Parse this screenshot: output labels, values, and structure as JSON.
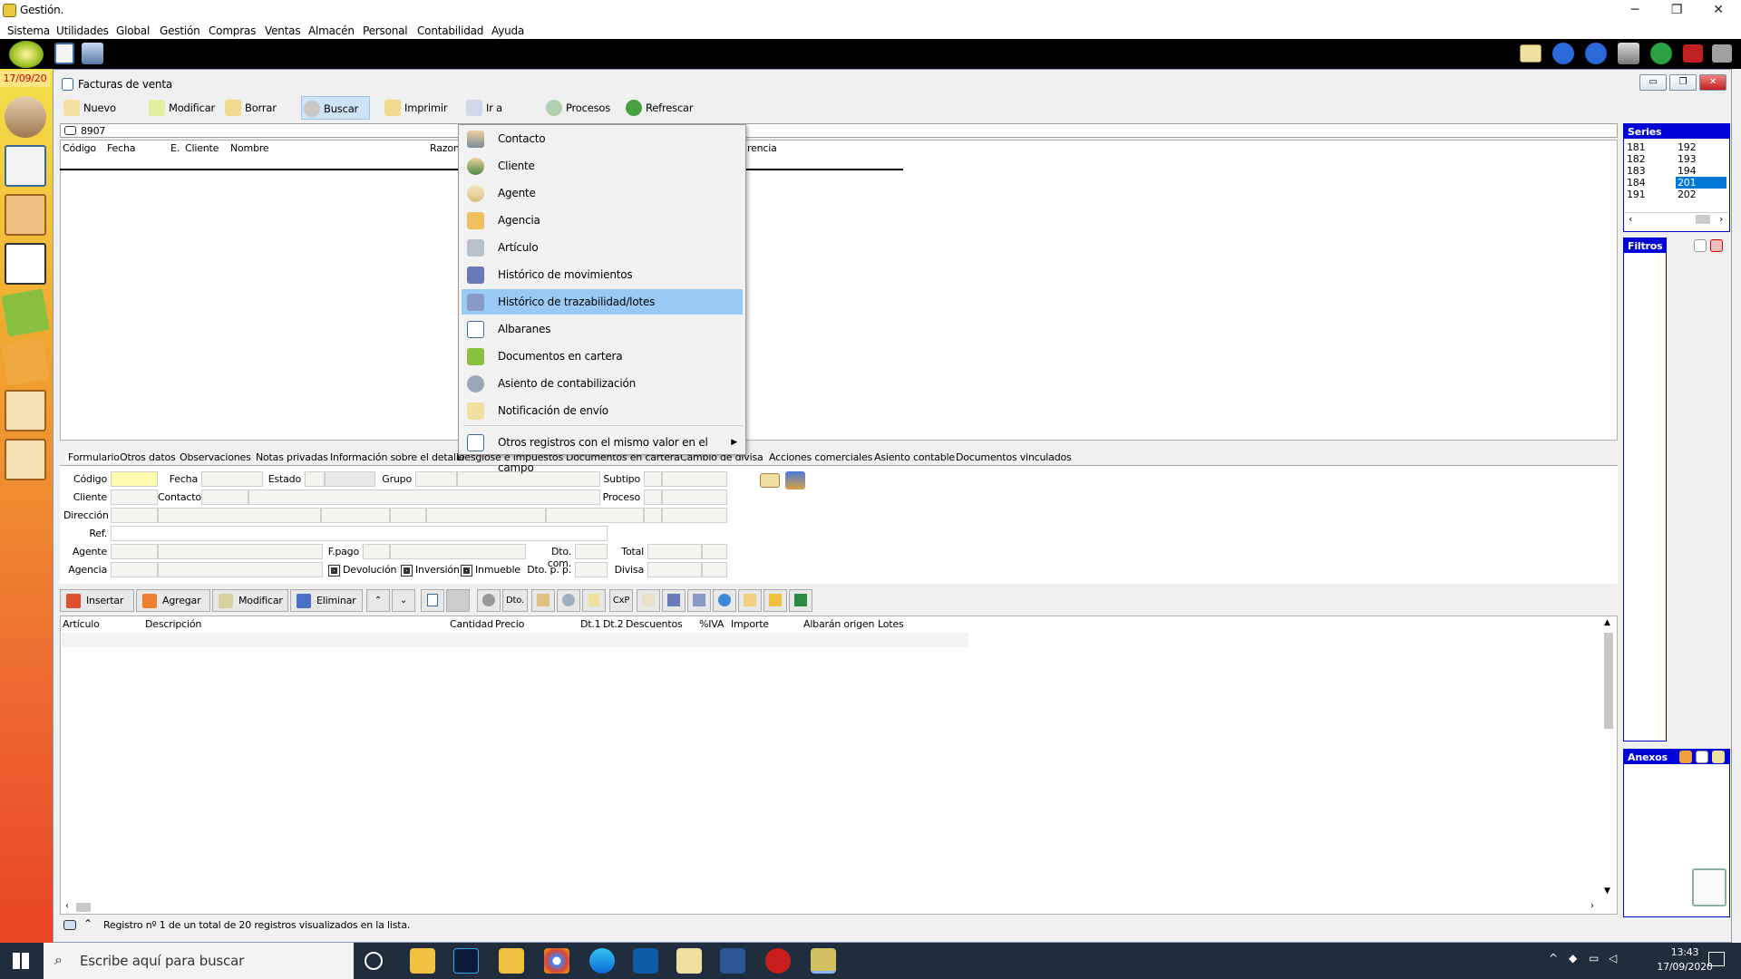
{
  "window": {
    "title": "Gestión.",
    "min": "─",
    "max": "❐",
    "close": "✕"
  },
  "menu": [
    "Sistema",
    "Utilidades",
    "Global",
    "Gestión",
    "Compras",
    "Ventas",
    "Almacén",
    "Personal",
    "Contabilidad",
    "Ayuda"
  ],
  "date_badge": "17/09/20",
  "child": {
    "title": "Facturas de venta"
  },
  "toolbar": [
    "Nuevo",
    "Modificar",
    "Borrar",
    "Buscar",
    "Imprimir",
    "Ir a",
    "Procesos",
    "Refrescar"
  ],
  "search": {
    "value": "8907"
  },
  "grid_headers": [
    "Código",
    "Fecha",
    "E.",
    "Cliente",
    "Nombre",
    "Razon",
    "rencia"
  ],
  "series": {
    "title": "Series",
    "col1": [
      "181",
      "182",
      "183",
      "184",
      "191"
    ],
    "col2": [
      "192",
      "193",
      "194",
      "201",
      "202"
    ],
    "selected": "201"
  },
  "filtros": {
    "title": "Filtros"
  },
  "anexos": {
    "title": "Anexos"
  },
  "dropdown": {
    "items": [
      "Contacto",
      "Cliente",
      "Agente",
      "Agencia",
      "Artículo",
      "Histórico de movimientos",
      "Histórico de trazabilidad/lotes",
      "Albaranes",
      "Documentos en cartera",
      "Asiento de contabilización",
      "Notificación de envío"
    ],
    "last": "Otros registros con el mismo valor en el campo",
    "highlighted": "Histórico de trazabilidad/lotes"
  },
  "tabs": [
    "Formulario",
    "Otros datos",
    "Observaciones",
    "Notas privadas",
    "Información sobre el detalle",
    "Desglose e impuestos",
    "Documentos en cartera",
    "Cambio de divisa",
    "Acciones comerciales",
    "Asiento contable",
    "Documentos vinculados"
  ],
  "form": {
    "codigo": "Código",
    "fecha": "Fecha",
    "estado": "Estado",
    "grupo": "Grupo",
    "subtipo": "Subtipo",
    "cliente": "Cliente",
    "contacto": "Contacto",
    "proceso": "Proceso",
    "direccion": "Dirección",
    "ref": "Ref.",
    "agente": "Agente",
    "fpago": "F.pago",
    "dtocom": "Dto. com.",
    "total": "Total",
    "agencia": "Agencia",
    "devolucion": "Devolución",
    "inversion": "Inversión",
    "inmueble": "Inmueble",
    "dtopp": "Dto. p. p.",
    "divisa": "Divisa"
  },
  "detail_toolbar": [
    "Insertar",
    "Agregar",
    "Modificar",
    "Eliminar"
  ],
  "detail_toolbar_small": {
    "up": "⌃",
    "down": "⌄",
    "dto": "Dto.",
    "cxp": "CxP"
  },
  "detail_headers": [
    "Artículo",
    "Descripción",
    "Cantidad",
    "Precio",
    "Dt.1",
    "Dt.2",
    "Descuentos",
    "%IVA",
    "Importe",
    "Albarán origen",
    "Lotes"
  ],
  "status": "Registro nº 1 de un total de 20 registros visualizados en la lista.",
  "taskbar": {
    "search_placeholder": "Escribe aquí para buscar",
    "time": "13:43",
    "date": "17/09/2020"
  },
  "colors": {
    "accent": "#0000d8",
    "highlight": "#99c9f5",
    "required": "#fffcb0"
  }
}
